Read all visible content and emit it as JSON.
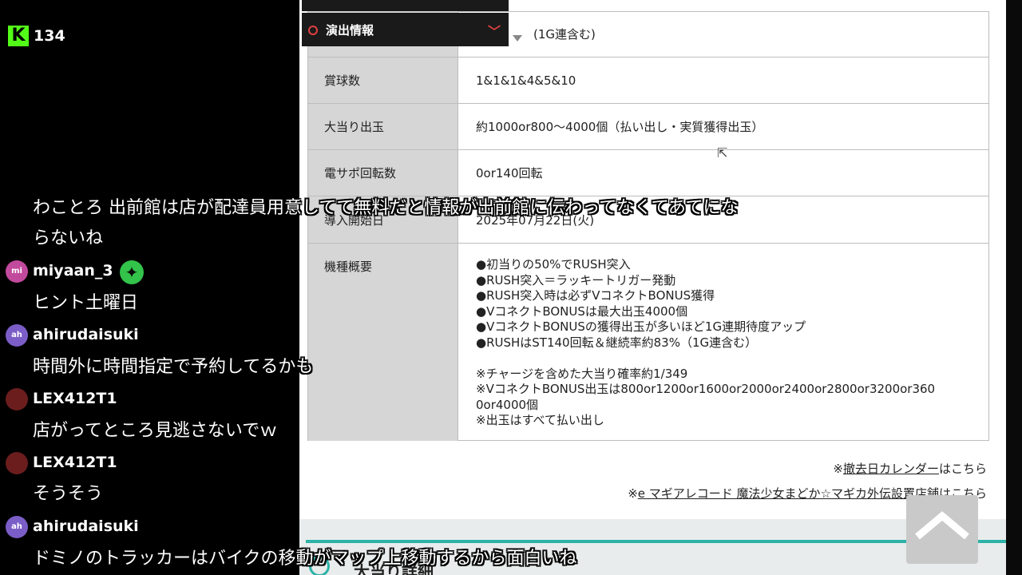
{
  "stream": {
    "viewer_count": "134",
    "logo_letter": "K"
  },
  "menu": {
    "label": "演出情報",
    "chevron": "⌄"
  },
  "spec_table": {
    "row0_value": "(1G連含む)",
    "rows": [
      {
        "label": "賞球数",
        "value": "1&1&1&4&5&10"
      },
      {
        "label": "大当り出玉",
        "value": "約1000or800～4000個（払い出し・実質獲得出玉）"
      },
      {
        "label": "電サポ回転数",
        "value": "0or140回転"
      },
      {
        "label": "導入開始日",
        "value": "2025年07月22日(火)"
      },
      {
        "label": "機種概要",
        "value": ""
      }
    ],
    "overview": [
      "●初当りの50%でRUSH突入",
      "●RUSH突入＝ラッキートリガー発動",
      "●RUSH突入時は必ずVコネクトBONUS獲得",
      "●VコネクトBONUSは最大出玉4000個",
      "●VコネクトBONUSの獲得出玉が多いほど1G連期待度アップ",
      "●RUSHはST140回転＆継続率約83%（1G連含む）",
      "",
      "※チャージを含めた大当り確率約1/349",
      "※VコネクトBONUS出玉は800or1200or1600or2000or2400or2800or3200or360",
      "0or4000個",
      "※出玉はすべて払い出し"
    ]
  },
  "links": {
    "removal_prefix": "※",
    "removal_link": "撤去日カレンダー",
    "removal_suffix": "はこちら",
    "shops_prefix": "※",
    "shops_link": "e マギアレコード 魔法少女まどか☆マギカ外伝設置店舗",
    "shops_suffix": "はこちら"
  },
  "next_section": {
    "title": "大当り詳細"
  },
  "chat": [
    {
      "user": "",
      "avatar": "",
      "lines": [
        "わことろ 出前館は店が配達員用意してて無料だと情報が出前館に伝わってなくてあてにな",
        "らないね"
      ]
    },
    {
      "user": "miyaan_3",
      "avatar": "mi",
      "lines": [
        "ヒント土曜日"
      ]
    },
    {
      "user": "ahirudaisuki",
      "avatar": "ah",
      "lines": [
        "時間外に時間指定で予約してるかも"
      ]
    },
    {
      "user": "LEX412T1",
      "avatar": "",
      "lines": [
        "店がってところ見逃さないでｗ"
      ]
    },
    {
      "user": "LEX412T1",
      "avatar": "",
      "lines": [
        "そうそう"
      ]
    },
    {
      "user": "ahirudaisuki",
      "avatar": "ah",
      "lines": [
        "ドミノのトラッカーはバイクの移動がマップ上移動するから面白いね"
      ]
    }
  ],
  "colors": {
    "kick_green": "#53fc18",
    "accent_teal": "#2bb3a7",
    "menu_red": "#e04040",
    "table_header_bg": "#d6d6d6"
  },
  "icons": {
    "scroll_top": "chevron-up-icon",
    "verified": "verified-badge-icon",
    "cursor": "mouse-cursor-icon"
  }
}
